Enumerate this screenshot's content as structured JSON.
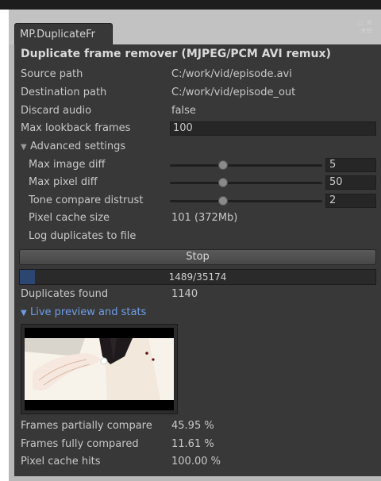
{
  "tab": {
    "title": "MP.DuplicateFr"
  },
  "header": {
    "title": "Duplicate frame remover (MJPEG/PCM AVI remux)"
  },
  "fields": {
    "source_path": {
      "label": "Source path",
      "value": "C:/work/vid/episode.avi"
    },
    "destination_path": {
      "label": "Destination path",
      "value": "C:/work/vid/episode_out"
    },
    "discard_audio": {
      "label": "Discard audio",
      "value": "false"
    },
    "max_lookback": {
      "label": "Max lookback frames",
      "value": "100"
    }
  },
  "advanced": {
    "label": "Advanced settings",
    "max_image_diff": {
      "label": "Max image diff",
      "value": "5",
      "slider": 0.35
    },
    "max_pixel_diff": {
      "label": "Max pixel diff",
      "value": "50",
      "slider": 0.35
    },
    "tone_compare": {
      "label": "Tone compare distrust",
      "value": "2",
      "slider": 0.35
    },
    "pixel_cache_size": {
      "label": "Pixel cache size",
      "value": "101 (372Mb)"
    },
    "log_duplicates": {
      "label": "Log duplicates to file"
    }
  },
  "stop_button": {
    "label": "Stop"
  },
  "progress": {
    "text": "1489/35174",
    "fraction": 0.042
  },
  "duplicates": {
    "label": "Duplicates found",
    "value": "1140"
  },
  "live_preview": {
    "label": "Live preview and stats"
  },
  "stats": {
    "partial": {
      "label": "Frames partially compare",
      "value": "45.95 %"
    },
    "full": {
      "label": "Frames fully compared",
      "value": "11.61 %"
    },
    "cache_hits": {
      "label": "Pixel cache hits",
      "value": "100.00 %"
    }
  },
  "icons": {
    "maximize": "maximize-icon",
    "close": "close-icon",
    "menu": "menu-icon"
  },
  "colors": {
    "panel": "#383838",
    "accent": "#6e9ee6",
    "progress_fill": "#2b4670"
  }
}
